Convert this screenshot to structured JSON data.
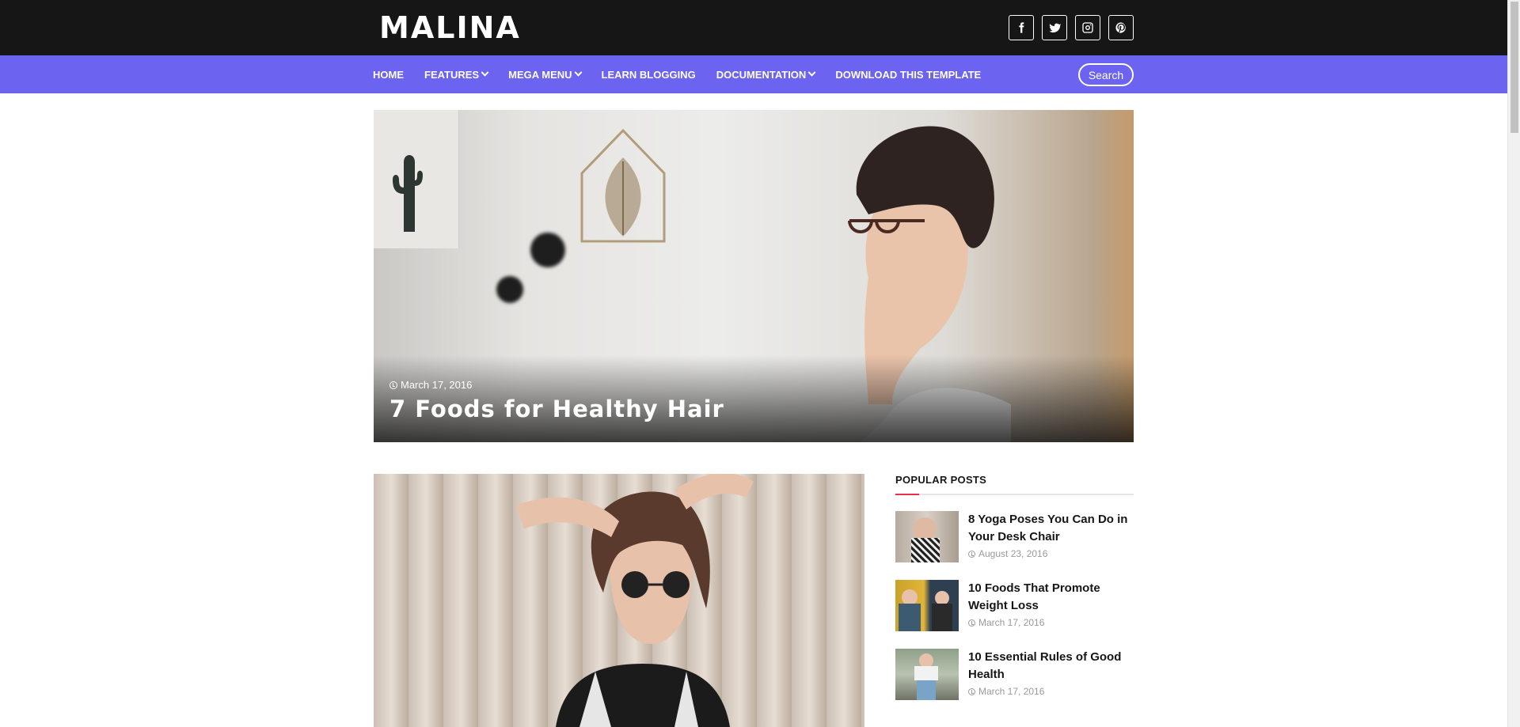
{
  "brand": {
    "logo_text": "MALINA"
  },
  "socials": [
    {
      "name": "facebook",
      "icon": "facebook-icon"
    },
    {
      "name": "twitter",
      "icon": "twitter-icon"
    },
    {
      "name": "instagram",
      "icon": "instagram-icon"
    },
    {
      "name": "pinterest",
      "icon": "pinterest-icon"
    }
  ],
  "nav": {
    "items": [
      {
        "label": "HOME",
        "has_dropdown": false
      },
      {
        "label": "FEATURES",
        "has_dropdown": true
      },
      {
        "label": "MEGA MENU",
        "has_dropdown": true
      },
      {
        "label": "LEARN BLOGGING",
        "has_dropdown": false
      },
      {
        "label": "DOCUMENTATION",
        "has_dropdown": true
      },
      {
        "label": "DOWNLOAD THIS TEMPLATE",
        "has_dropdown": false
      }
    ],
    "search_label": "Search"
  },
  "hero": {
    "date": "March 17, 2016",
    "title": "7 Foods for Healthy Hair"
  },
  "sidebar": {
    "title": "POPULAR POSTS",
    "posts": [
      {
        "title": "8 Yoga Poses You Can Do in Your Desk Chair",
        "date": "August 23, 2016"
      },
      {
        "title": "10 Foods That Promote Weight Loss",
        "date": "March 17, 2016"
      },
      {
        "title": "10 Essential Rules of Good Health",
        "date": "March 17, 2016"
      }
    ]
  },
  "colors": {
    "topbar": "#161616",
    "navbar": "#6c63f0",
    "accent": "#e8304a"
  }
}
